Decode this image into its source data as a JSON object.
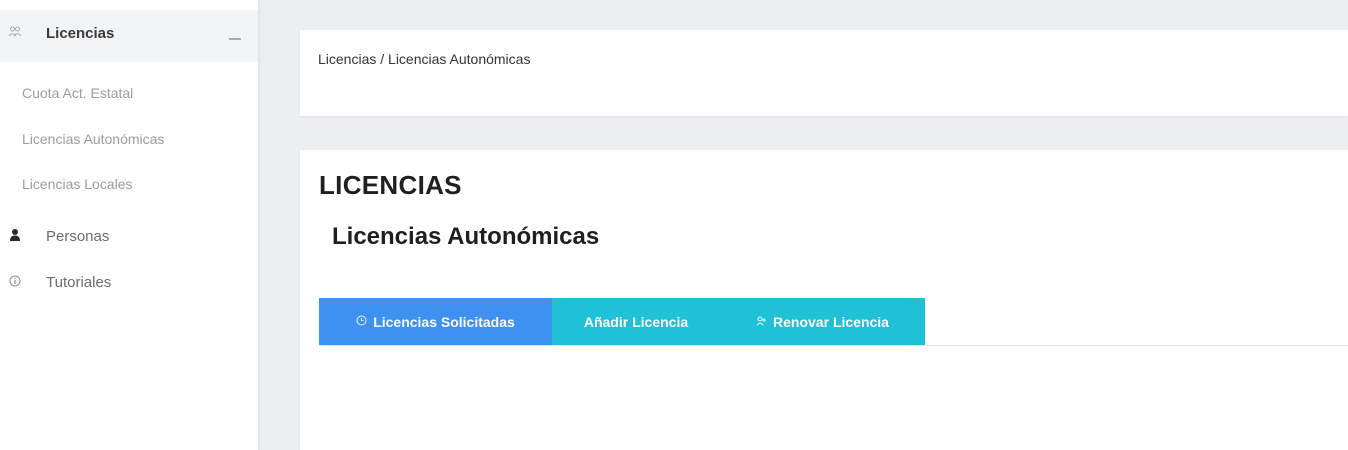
{
  "sidebar": {
    "group": {
      "label": "Licencias",
      "icon": "users-icon"
    },
    "sub_items": [
      {
        "label": "Cuota Act. Estatal"
      },
      {
        "label": "Licencias Autonómicas"
      },
      {
        "label": "Licencias Locales"
      }
    ],
    "items": [
      {
        "label": "Personas",
        "icon": "person-icon"
      },
      {
        "label": "Tutoriales",
        "icon": "info-icon"
      }
    ]
  },
  "breadcrumb": {
    "text": "Licencias / Licencias Autonómicas"
  },
  "main": {
    "title": "LICENCIAS",
    "subtitle": "Licencias Autonómicas",
    "tabs": [
      {
        "label": "Licencias Solicitadas",
        "icon": "clock-icon",
        "color": "#3e91f0",
        "active": true
      },
      {
        "label": "Añadir Licencia",
        "icon": "",
        "color": "#1ec1d6",
        "active": false
      },
      {
        "label": "Renovar Licencia",
        "icon": "renew-icon",
        "color": "#1ec1d6",
        "active": false
      }
    ]
  },
  "colors": {
    "accent_blue": "#3e91f0",
    "accent_cyan": "#1ec1d6",
    "background": "#eceef1"
  }
}
